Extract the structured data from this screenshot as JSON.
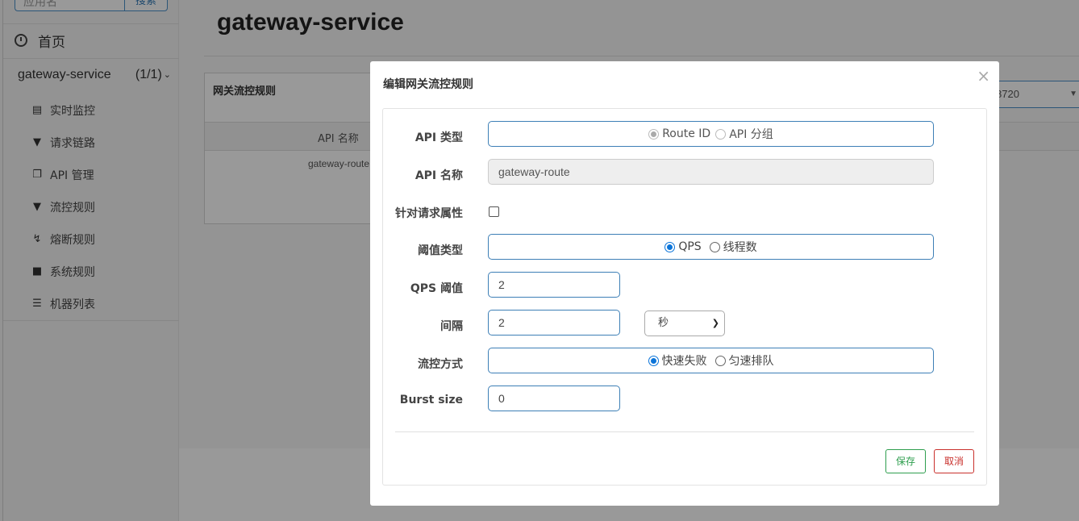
{
  "sidebar": {
    "search_placeholder": "应用名",
    "search_button": "搜索",
    "home_label": "首页",
    "app_name": "gateway-service",
    "app_count": "(1/1)",
    "items": [
      {
        "label": "实时监控",
        "icon": "bar-chart-icon"
      },
      {
        "label": "请求链路",
        "icon": "filter-icon"
      },
      {
        "label": "API 管理",
        "icon": "tags-icon"
      },
      {
        "label": "流控规则",
        "icon": "filter-icon"
      },
      {
        "label": "熔断规则",
        "icon": "flash-icon"
      },
      {
        "label": "系统规则",
        "icon": "lock-icon"
      },
      {
        "label": "机器列表",
        "icon": "list-icon"
      }
    ]
  },
  "main": {
    "page_title": "gateway-service",
    "panel_title": "网关流控规则",
    "column_api_name": "API 名称",
    "row_route": "gateway-route",
    "ip_select_value": "8720"
  },
  "modal": {
    "title": "编辑网关流控规则",
    "close_symbol": "×",
    "api_type_label": "API 类型",
    "api_type_options": [
      "Route ID",
      "API 分组"
    ],
    "api_type_selected": "Route ID",
    "api_name_label": "API 名称",
    "api_name_value": "gateway-route",
    "param_attr_label": "针对请求属性",
    "threshold_type_label": "阈值类型",
    "threshold_type_options": [
      "QPS",
      "线程数"
    ],
    "threshold_type_selected": "QPS",
    "qps_label": "QPS 阈值",
    "qps_value": "2",
    "interval_label": "间隔",
    "interval_value": "2",
    "interval_unit": "秒",
    "control_label": "流控方式",
    "control_options": [
      "快速失败",
      "匀速排队"
    ],
    "control_selected": "快速失败",
    "burst_label": "Burst size",
    "burst_value": "0",
    "save_label": "保存",
    "cancel_label": "取消"
  }
}
